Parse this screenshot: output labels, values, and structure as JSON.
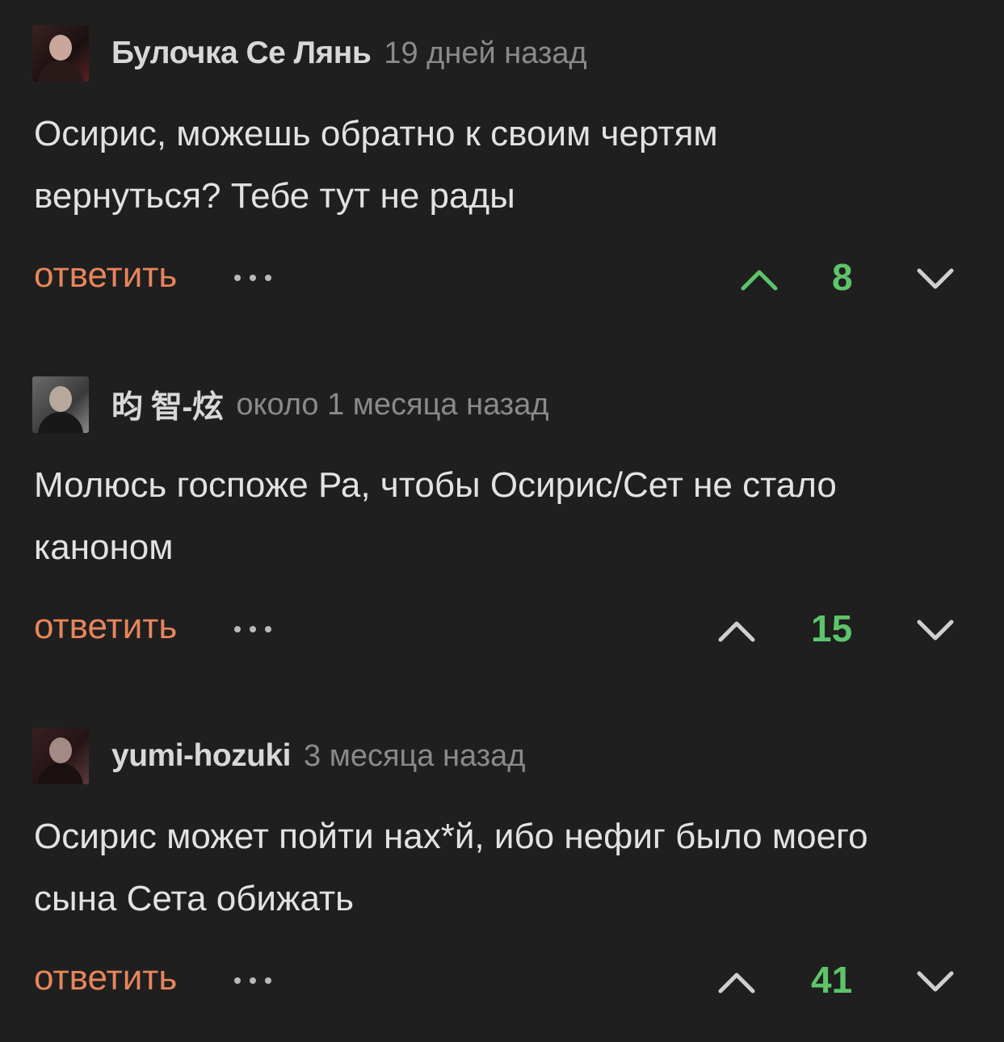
{
  "colors": {
    "background": "#1f1f1f",
    "reply_link": "#e8855b",
    "rating_positive": "#5ec46a",
    "upvote_active": "#5ec46a",
    "icon_default": "#cfcfcf"
  },
  "comments": [
    {
      "username": "Булочка Се Лянь",
      "timestamp": "19 дней назад",
      "text_lines": [
        "Осирис, можешь обратно к своим чертям",
        "вернуться? Тебе тут не рады"
      ],
      "reply_label": "ответить",
      "rating": "8",
      "upvoted": true,
      "icons": {
        "more": "more-dots-icon",
        "up": "chevron-up-icon",
        "down": "chevron-down-icon"
      }
    },
    {
      "username": "昀 智-炫",
      "timestamp": "около 1 месяца назад",
      "text_lines": [
        "Молюсь госпоже Ра, чтобы Осирис/Сет не стало",
        "каноном"
      ],
      "reply_label": "ответить",
      "rating": "15",
      "upvoted": false,
      "icons": {
        "more": "more-dots-icon",
        "up": "chevron-up-icon",
        "down": "chevron-down-icon"
      }
    },
    {
      "username": "yumi-hozuki",
      "timestamp": "3 месяца назад",
      "text_lines": [
        "Осирис может пойти нах*й, ибо нефиг было моего",
        "сына Сета обижать"
      ],
      "reply_label": "ответить",
      "rating": "41",
      "upvoted": false,
      "icons": {
        "more": "more-dots-icon",
        "up": "chevron-up-icon",
        "down": "chevron-down-icon"
      }
    }
  ]
}
